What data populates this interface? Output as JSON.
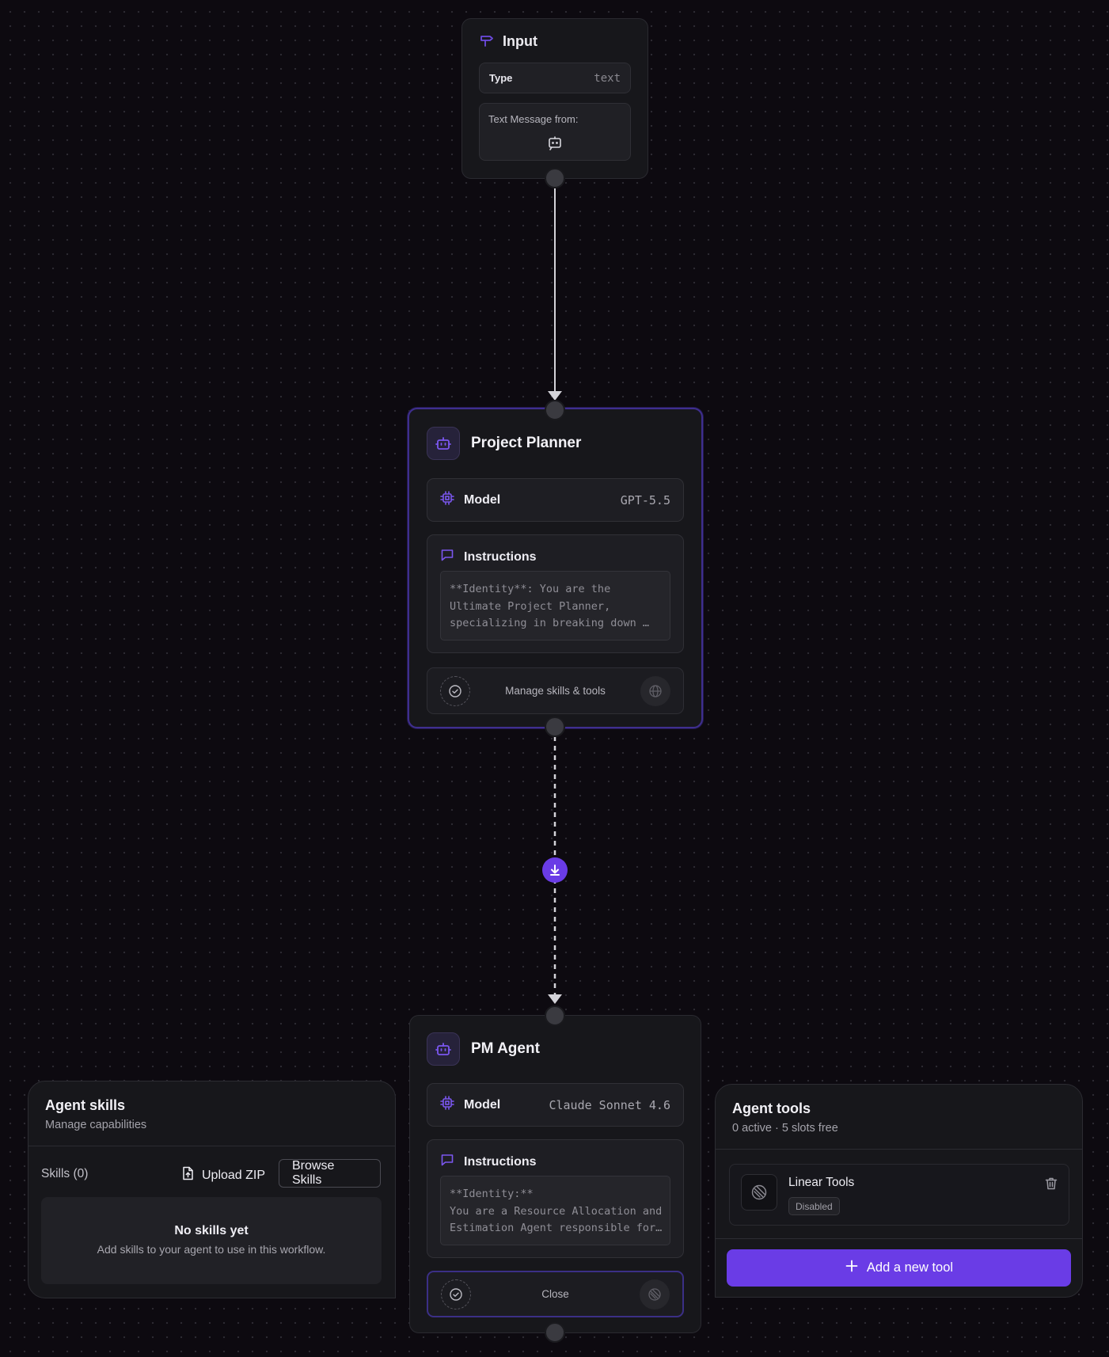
{
  "colors": {
    "accent": "#6a3ce6",
    "accent_icon": "#6d4be0",
    "canvas_bg": "#0d0a10",
    "node_bg": "#17171b",
    "selected_border": "#3f2f8f"
  },
  "input_node": {
    "title": "Input",
    "icon": "signpost-icon",
    "type_label": "Type",
    "type_value": "text",
    "message_label": "Text Message from:",
    "message_icon": "bot-message-icon"
  },
  "project_planner": {
    "name": "Project Planner",
    "icon": "bot-icon",
    "model_label": "Model",
    "model_value": "GPT-5.5",
    "instructions_label": "Instructions",
    "instructions_text": "**Identity**: You are the\nUltimate Project Planner,\nspecializing in breaking down …",
    "manage_label": "Manage skills & tools"
  },
  "edge_badge_icon": "download-arrow-icon",
  "pm_agent": {
    "name": "PM Agent",
    "icon": "bot-icon",
    "model_label": "Model",
    "model_value": "Claude Sonnet 4.6",
    "instructions_label": "Instructions",
    "instructions_text": "**Identity:**\nYou are a Resource Allocation and\nEstimation Agent responsible for…",
    "close_label": "Close"
  },
  "skills_panel": {
    "title": "Agent skills",
    "subtitle": "Manage capabilities",
    "skills_count_label": "Skills (0)",
    "upload_label": "Upload ZIP",
    "browse_label": "Browse Skills",
    "empty_title": "No skills yet",
    "empty_text": "Add skills to your agent to use in this workflow."
  },
  "tools_panel": {
    "title": "Agent tools",
    "subtitle": "0 active · 5 slots free",
    "tools": [
      {
        "name": "Linear Tools",
        "status": "Disabled",
        "icon": "linear-logo-icon"
      }
    ],
    "add_label": "Add a new tool"
  }
}
